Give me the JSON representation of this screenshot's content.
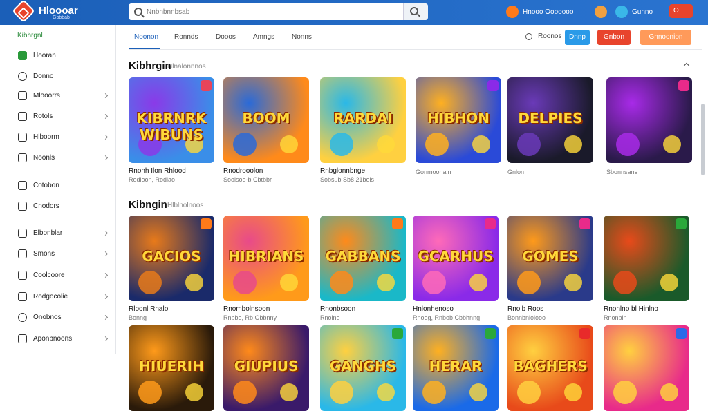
{
  "header": {
    "brand": "Hloooar",
    "brand_sub": "Gbbbab",
    "search_placeholder": "Nnbnbnnbsab",
    "right_link_1": "Hnooo Ooooooo",
    "right_link_2": "Gunno",
    "user_btn": "O"
  },
  "sidebar": {
    "heading": "Kibhrgnl",
    "items": [
      {
        "label": "Hooran",
        "icon": "home-icon",
        "chevron": false
      },
      {
        "label": "Donno",
        "icon": "compass-icon",
        "chevron": false
      },
      {
        "label": "Mlooorrs",
        "icon": "grid-icon",
        "chevron": true
      },
      {
        "label": "Rotols",
        "icon": "list-icon",
        "chevron": true
      },
      {
        "label": "Hlboorm",
        "icon": "chart-icon",
        "chevron": true
      },
      {
        "label": "Noonls",
        "icon": "folder-icon",
        "chevron": true
      },
      {
        "label": "Cotobon",
        "icon": "tag-icon",
        "chevron": false
      },
      {
        "label": "Cnodors",
        "icon": "star-icon",
        "chevron": false
      },
      {
        "label": "Elbonblar",
        "icon": "layers-icon",
        "chevron": true
      },
      {
        "label": "Smons",
        "icon": "clock-icon",
        "chevron": true
      },
      {
        "label": "Coolcoore",
        "icon": "settings-icon",
        "chevron": true
      },
      {
        "label": "Rodgocolie",
        "icon": "badge-icon",
        "chevron": true
      },
      {
        "label": "Onobnos",
        "icon": "bell-icon",
        "chevron": true
      },
      {
        "label": "Aponbnoons",
        "icon": "user-icon",
        "chevron": true
      }
    ]
  },
  "tabs": {
    "items": [
      "Noonon",
      "Ronnds",
      "Dooos",
      "Amngs",
      "Nonns"
    ],
    "filter_label": "Roonos",
    "btn_blue": "Dnnp",
    "btn_red": "Gnbon",
    "btn_orange": "Gnnoonion"
  },
  "sections": [
    {
      "title": "Kibhrgin",
      "subtitle": "Hlnalonnnos",
      "cards": [
        {
          "thumb_title": "KIBRNRK WIBUNS",
          "name": "Rnonh Ilon Rhlood",
          "meta": "Rodloon, Rodlao",
          "bg1": "#3a8ee8",
          "bg2": "#8a3ae8",
          "badge": "#e8445a"
        },
        {
          "thumb_title": "BOOM",
          "name": "Rnodrooolon",
          "meta": "Soolsoo-b Cbtbbr",
          "bg1": "#ff8a1a",
          "bg2": "#2a6ad8",
          "badge": ""
        },
        {
          "thumb_title": "RARDAI",
          "name": "Rnbglonnbnge",
          "meta": "Sobsub Sb8 21bols",
          "bg1": "#ffd040",
          "bg2": "#2ab8e8",
          "badge": ""
        },
        {
          "thumb_title": "HIBHON",
          "name": "",
          "meta": "Gonmoonaln",
          "bg1": "#2a4ad8",
          "bg2": "#ffb020",
          "badge": "#8a2ae8"
        },
        {
          "thumb_title": "DELPIES",
          "name": "",
          "meta": "Gnlon",
          "bg1": "#1a1a2a",
          "bg2": "#6a3ab8",
          "badge": ""
        },
        {
          "thumb_title": "",
          "name": "",
          "meta": "Sbonnsans",
          "bg1": "#2a1a4a",
          "bg2": "#a82ae8",
          "badge": "#e82a8a"
        }
      ]
    },
    {
      "title": "Kibngin",
      "subtitle": "Hlblnolnoos",
      "cards": [
        {
          "thumb_title": "GACIOS",
          "name": "Rloonl Rnalo",
          "meta": "Bonng",
          "bg1": "#1a2a6a",
          "bg2": "#e87a1a",
          "badge": "#ff7a1a"
        },
        {
          "thumb_title": "HIBRIANS",
          "name": "Rnombolnsoon",
          "meta": "Rnbbo, Rb Obbnny",
          "bg1": "#ff9a1a",
          "bg2": "#e84a8a",
          "badge": ""
        },
        {
          "thumb_title": "GABBANS",
          "name": "Rnonbsoon",
          "meta": "Rnolno",
          "bg1": "#1ab8c8",
          "bg2": "#ff8a1a",
          "badge": "#ff7a1a"
        },
        {
          "thumb_title": "GCARHUS",
          "name": "Hnlonhenoso",
          "meta": "Rnoog, Rnbob Cbbhnng",
          "bg1": "#8a2ae8",
          "bg2": "#ff6ab8",
          "badge": "#e82a8a"
        },
        {
          "thumb_title": "GOMES",
          "name": "Rnolb Roos",
          "meta": "Bonnbnlolooo",
          "bg1": "#2a3a8a",
          "bg2": "#ff9a1a",
          "badge": "#e82a8a"
        },
        {
          "thumb_title": "",
          "name": "Rnonlno bl Hinlno",
          "meta": "Rnonbln",
          "bg1": "#1a5a2a",
          "bg2": "#e84a1a",
          "badge": "#2aa83a"
        }
      ]
    },
    {
      "title": "",
      "subtitle": "",
      "cards": [
        {
          "thumb_title": "HIUERIH",
          "bg1": "#2a1a0a",
          "bg2": "#ff9a1a",
          "badge": ""
        },
        {
          "thumb_title": "GIUPIUS",
          "bg1": "#3a1a6a",
          "bg2": "#ff8a1a",
          "badge": ""
        },
        {
          "thumb_title": "GANGHS",
          "bg1": "#2ab8e8",
          "bg2": "#ffd040",
          "badge": "#2aa83a"
        },
        {
          "thumb_title": "HERAR",
          "bg1": "#1a6ae8",
          "bg2": "#ffb020",
          "badge": "#2aa83a"
        },
        {
          "thumb_title": "BAGHERS",
          "bg1": "#e84a1a",
          "bg2": "#ffd040",
          "badge": "#e82a2a"
        },
        {
          "thumb_title": "",
          "bg1": "#e82a8a",
          "bg2": "#ffd040",
          "badge": "#2a6ae8"
        }
      ]
    }
  ]
}
